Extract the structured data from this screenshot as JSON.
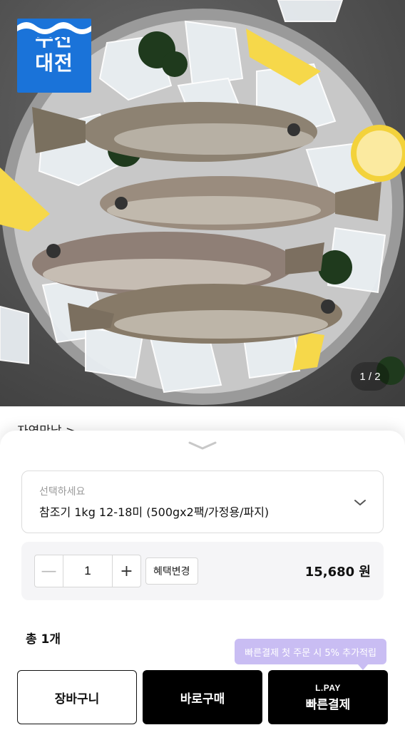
{
  "product_image": {
    "badge_line1": "수산",
    "badge_line2": "대전",
    "pager": "1 / 2",
    "badge_color": "#1a73d9"
  },
  "seller_peek": "자연만남 >",
  "sheet": {
    "handle_icon": "chevron-down-icon",
    "option": {
      "placeholder": "선택하세요",
      "selected": "참조기 1kg 12-18미 (500gx2팩/가정용/파지)"
    },
    "quantity": {
      "minus": "—",
      "value": "1",
      "plus": "+",
      "benefit_label": "혜택변경",
      "price": "15,680 원"
    },
    "total_label": "총 1개",
    "tooltip": "빠른결제 첫 주문 시 5% 추가적립",
    "tooltip_color": "#c9bdf3",
    "buttons": {
      "cart": "장바구니",
      "buy_now": "바로구매",
      "lpay_brand": "L.PAY",
      "lpay_label": "빠른결제"
    }
  }
}
